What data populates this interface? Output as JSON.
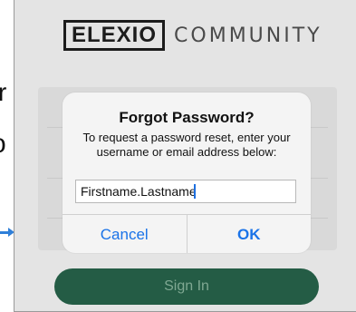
{
  "app": {
    "logo_mark": "ELEXIO",
    "logo_word": "COMMUNITY",
    "sign_in_label": "Sign In"
  },
  "dialog": {
    "title": "Forgot Password?",
    "message": "To request a password reset, enter your username or email address below:",
    "input_value": "Firstname.Lastname",
    "cancel_label": "Cancel",
    "ok_label": "OK"
  },
  "colors": {
    "accent": "#1a73e8",
    "sign_in_button": "#245c45"
  }
}
